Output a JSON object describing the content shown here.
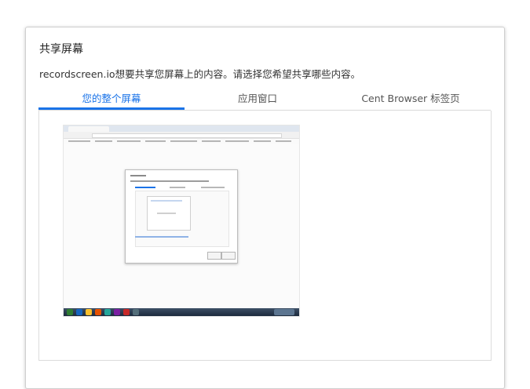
{
  "dialog": {
    "title": "共享屏幕",
    "description": "recordscreen.io想要共享您屏幕上的内容。请选择您希望共享哪些内容。"
  },
  "tabs": [
    {
      "label": "您的整个屏幕",
      "active": true
    },
    {
      "label": "应用窗口",
      "active": false
    },
    {
      "label": "Cent Browser 标签页",
      "active": false
    }
  ],
  "preview": {
    "icon": "screen-thumbnail",
    "description_visible": false
  },
  "colors": {
    "accent": "#1a73e8",
    "border": "#dcdcdc",
    "text": "#222222"
  }
}
